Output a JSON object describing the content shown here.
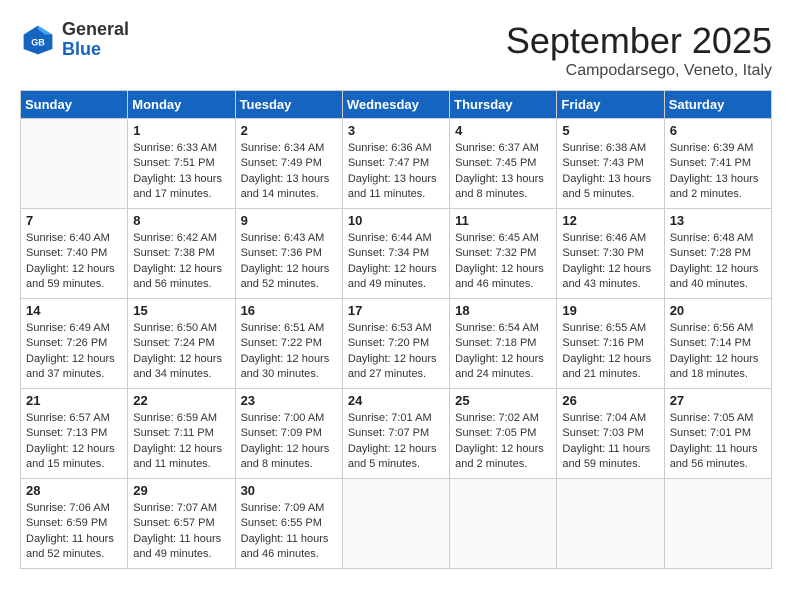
{
  "header": {
    "logo_line1": "General",
    "logo_line2": "Blue",
    "month": "September 2025",
    "location": "Campodarsego, Veneto, Italy"
  },
  "days_of_week": [
    "Sunday",
    "Monday",
    "Tuesday",
    "Wednesday",
    "Thursday",
    "Friday",
    "Saturday"
  ],
  "weeks": [
    [
      {
        "day": "",
        "info": ""
      },
      {
        "day": "1",
        "info": "Sunrise: 6:33 AM\nSunset: 7:51 PM\nDaylight: 13 hours\nand 17 minutes."
      },
      {
        "day": "2",
        "info": "Sunrise: 6:34 AM\nSunset: 7:49 PM\nDaylight: 13 hours\nand 14 minutes."
      },
      {
        "day": "3",
        "info": "Sunrise: 6:36 AM\nSunset: 7:47 PM\nDaylight: 13 hours\nand 11 minutes."
      },
      {
        "day": "4",
        "info": "Sunrise: 6:37 AM\nSunset: 7:45 PM\nDaylight: 13 hours\nand 8 minutes."
      },
      {
        "day": "5",
        "info": "Sunrise: 6:38 AM\nSunset: 7:43 PM\nDaylight: 13 hours\nand 5 minutes."
      },
      {
        "day": "6",
        "info": "Sunrise: 6:39 AM\nSunset: 7:41 PM\nDaylight: 13 hours\nand 2 minutes."
      }
    ],
    [
      {
        "day": "7",
        "info": "Sunrise: 6:40 AM\nSunset: 7:40 PM\nDaylight: 12 hours\nand 59 minutes."
      },
      {
        "day": "8",
        "info": "Sunrise: 6:42 AM\nSunset: 7:38 PM\nDaylight: 12 hours\nand 56 minutes."
      },
      {
        "day": "9",
        "info": "Sunrise: 6:43 AM\nSunset: 7:36 PM\nDaylight: 12 hours\nand 52 minutes."
      },
      {
        "day": "10",
        "info": "Sunrise: 6:44 AM\nSunset: 7:34 PM\nDaylight: 12 hours\nand 49 minutes."
      },
      {
        "day": "11",
        "info": "Sunrise: 6:45 AM\nSunset: 7:32 PM\nDaylight: 12 hours\nand 46 minutes."
      },
      {
        "day": "12",
        "info": "Sunrise: 6:46 AM\nSunset: 7:30 PM\nDaylight: 12 hours\nand 43 minutes."
      },
      {
        "day": "13",
        "info": "Sunrise: 6:48 AM\nSunset: 7:28 PM\nDaylight: 12 hours\nand 40 minutes."
      }
    ],
    [
      {
        "day": "14",
        "info": "Sunrise: 6:49 AM\nSunset: 7:26 PM\nDaylight: 12 hours\nand 37 minutes."
      },
      {
        "day": "15",
        "info": "Sunrise: 6:50 AM\nSunset: 7:24 PM\nDaylight: 12 hours\nand 34 minutes."
      },
      {
        "day": "16",
        "info": "Sunrise: 6:51 AM\nSunset: 7:22 PM\nDaylight: 12 hours\nand 30 minutes."
      },
      {
        "day": "17",
        "info": "Sunrise: 6:53 AM\nSunset: 7:20 PM\nDaylight: 12 hours\nand 27 minutes."
      },
      {
        "day": "18",
        "info": "Sunrise: 6:54 AM\nSunset: 7:18 PM\nDaylight: 12 hours\nand 24 minutes."
      },
      {
        "day": "19",
        "info": "Sunrise: 6:55 AM\nSunset: 7:16 PM\nDaylight: 12 hours\nand 21 minutes."
      },
      {
        "day": "20",
        "info": "Sunrise: 6:56 AM\nSunset: 7:14 PM\nDaylight: 12 hours\nand 18 minutes."
      }
    ],
    [
      {
        "day": "21",
        "info": "Sunrise: 6:57 AM\nSunset: 7:13 PM\nDaylight: 12 hours\nand 15 minutes."
      },
      {
        "day": "22",
        "info": "Sunrise: 6:59 AM\nSunset: 7:11 PM\nDaylight: 12 hours\nand 11 minutes."
      },
      {
        "day": "23",
        "info": "Sunrise: 7:00 AM\nSunset: 7:09 PM\nDaylight: 12 hours\nand 8 minutes."
      },
      {
        "day": "24",
        "info": "Sunrise: 7:01 AM\nSunset: 7:07 PM\nDaylight: 12 hours\nand 5 minutes."
      },
      {
        "day": "25",
        "info": "Sunrise: 7:02 AM\nSunset: 7:05 PM\nDaylight: 12 hours\nand 2 minutes."
      },
      {
        "day": "26",
        "info": "Sunrise: 7:04 AM\nSunset: 7:03 PM\nDaylight: 11 hours\nand 59 minutes."
      },
      {
        "day": "27",
        "info": "Sunrise: 7:05 AM\nSunset: 7:01 PM\nDaylight: 11 hours\nand 56 minutes."
      }
    ],
    [
      {
        "day": "28",
        "info": "Sunrise: 7:06 AM\nSunset: 6:59 PM\nDaylight: 11 hours\nand 52 minutes."
      },
      {
        "day": "29",
        "info": "Sunrise: 7:07 AM\nSunset: 6:57 PM\nDaylight: 11 hours\nand 49 minutes."
      },
      {
        "day": "30",
        "info": "Sunrise: 7:09 AM\nSunset: 6:55 PM\nDaylight: 11 hours\nand 46 minutes."
      },
      {
        "day": "",
        "info": ""
      },
      {
        "day": "",
        "info": ""
      },
      {
        "day": "",
        "info": ""
      },
      {
        "day": "",
        "info": ""
      }
    ]
  ]
}
